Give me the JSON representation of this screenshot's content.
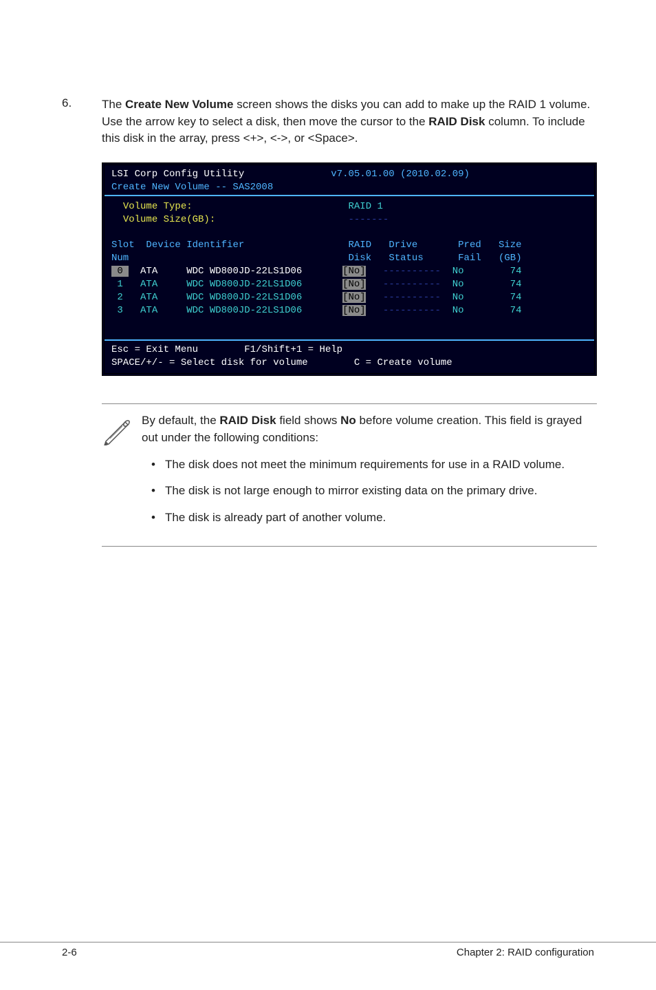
{
  "step": {
    "number": "6.",
    "text_before_b1": "The ",
    "bold1": "Create New Volume",
    "text_mid1": " screen shows the disks you can add to make up the RAID 1 volume. Use the arrow key to select a disk, then move the cursor to the ",
    "bold2": "RAID Disk",
    "text_after": " column. To include this disk in the array, press <+>, <->, or <Space>."
  },
  "terminal": {
    "title_left": "LSI Corp Config Utility",
    "title_right": "v7.05.01.00 (2010.02.09)",
    "subtitle": "Create New Volume -- SAS2008",
    "vol_type_label": "Volume Type:",
    "vol_type_value": "RAID 1",
    "vol_size_label": "Volume Size(GB):",
    "vol_size_value": "-------",
    "col_header1_l1": "Slot",
    "col_header1_l2": "Num",
    "col_header2": "Device Identifier",
    "col_header3_l1": "RAID",
    "col_header3_l2": "Disk",
    "col_header4_l1": "Drive",
    "col_header4_l2": "Status",
    "col_header5_l1": "Pred",
    "col_header5_l2": "Fail",
    "col_header6_l1": "Size",
    "col_header6_l2": "(GB)",
    "rows": [
      {
        "slot": " 0 ",
        "dev": "ATA     WDC WD800JD-22LS1D06",
        "raid": "[No]",
        "status": "----------",
        "pred": "No",
        "size": "74"
      },
      {
        "slot": " 1 ",
        "dev": "ATA     WDC WD800JD-22LS1D06",
        "raid": "[No]",
        "status": "----------",
        "pred": "No",
        "size": "74"
      },
      {
        "slot": " 2 ",
        "dev": "ATA     WDC WD800JD-22LS1D06",
        "raid": "[No]",
        "status": "----------",
        "pred": "No",
        "size": "74"
      },
      {
        "slot": " 3 ",
        "dev": "ATA     WDC WD800JD-22LS1D06",
        "raid": "[No]",
        "status": "----------",
        "pred": "No",
        "size": "74"
      }
    ],
    "footer_l1_a": "Esc = Exit Menu",
    "footer_l1_b": "F1/Shift+1 = Help",
    "footer_l2_a": "SPACE/+/- = Select disk for volume",
    "footer_l2_b": "C = Create volume"
  },
  "note": {
    "intro_pre": "By default, the ",
    "intro_b1": "RAID Disk",
    "intro_mid": " field shows ",
    "intro_b2": "No",
    "intro_post": " before volume creation. This field is grayed out under the following conditions:",
    "bullets": [
      "The disk does not meet the minimum requirements for use in a RAID volume.",
      "The disk is not large enough to mirror existing data on the primary drive.",
      "The disk is already part of another volume."
    ]
  },
  "footer": {
    "left": "2-6",
    "right": "Chapter 2: RAID configuration"
  }
}
